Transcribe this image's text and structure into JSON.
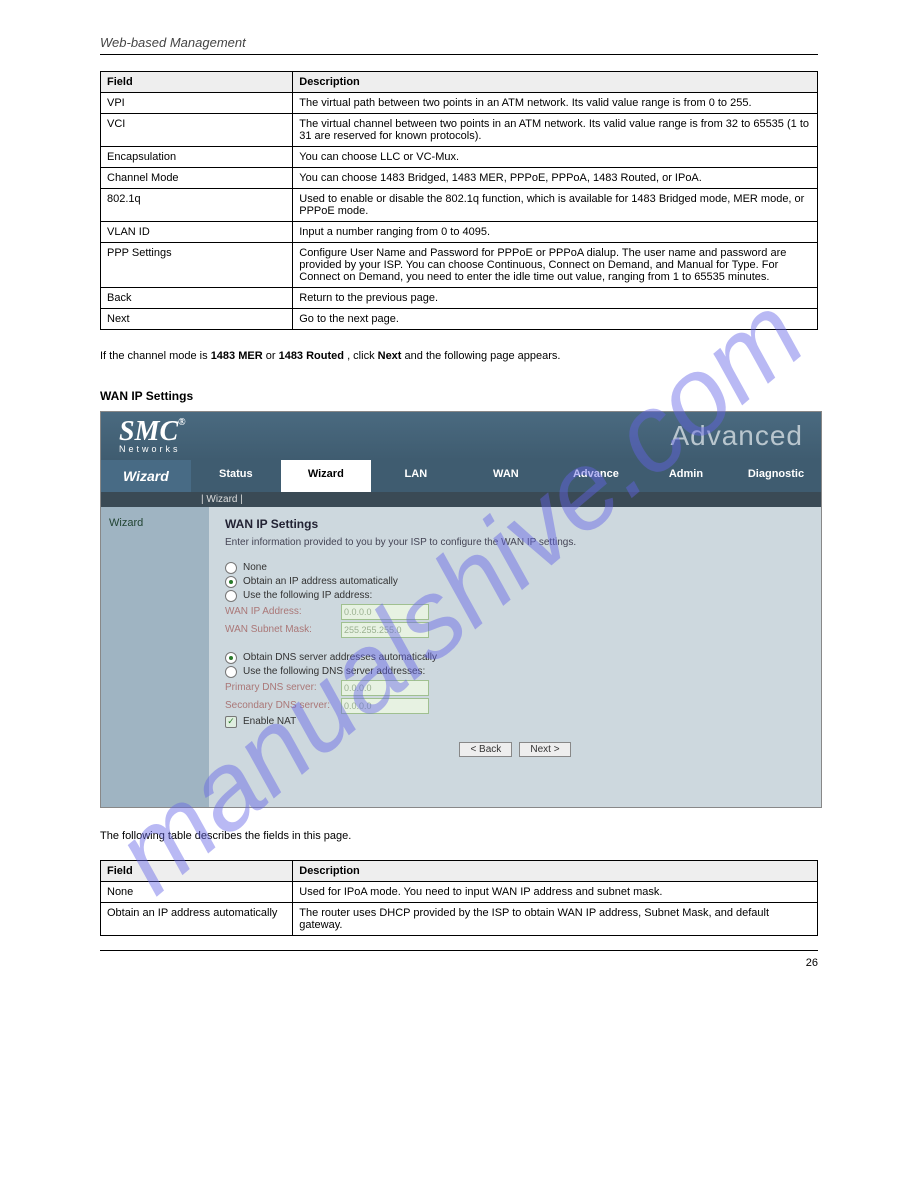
{
  "watermark": "manualshive.com",
  "section_title": "Web-based Management",
  "page_number": "26",
  "table1": {
    "header_field": "Field",
    "header_desc": "Description",
    "rows": [
      {
        "field": "VPI",
        "desc": "The virtual path between two points in an ATM network. Its valid value range is from 0 to 255."
      },
      {
        "field": "VCI",
        "desc": "The virtual channel between two points in an ATM network. Its valid value range is from 32 to 65535 (1 to 31 are reserved for known protocols)."
      },
      {
        "field": "Encapsulation",
        "desc": "You can choose LLC or VC-Mux."
      },
      {
        "field": "Channel Mode",
        "desc": "You can choose 1483 Bridged, 1483 MER, PPPoE, PPPoA, 1483 Routed, or IPoA."
      },
      {
        "field": "802.1q",
        "desc": "Used to enable or disable the 802.1q function, which is available for 1483 Bridged mode, MER mode, or PPPoE mode."
      },
      {
        "field": "VLAN ID",
        "desc": "Input a number ranging from 0 to 4095."
      },
      {
        "field": "PPP Settings",
        "desc": "Configure User Name and Password for PPPoE or PPPoA dialup. The user name and password are provided by your ISP. You can choose Continuous, Connect on Demand, and Manual for Type. For Connect on Demand, you need to enter the idle time out value, ranging from 1 to 65535 minutes."
      },
      {
        "field": "Back",
        "desc": "Return to the previous page."
      },
      {
        "field": "Next",
        "desc": "Go to the next page."
      }
    ]
  },
  "after_table_text_1": "If the channel mode is ",
  "after_table_bold_1": "1483 MER",
  "after_table_text_2": " or ",
  "after_table_bold_2": "1483 Routed",
  "after_table_text_3": ", click ",
  "after_table_bold_3": "Next",
  "after_table_text_4": " and the following page appears.",
  "subhead": "WAN IP Settings",
  "router": {
    "logo_main": "SMC",
    "logo_reg": "®",
    "logo_sub": "Networks",
    "advanced": "Advanced",
    "wizard_head": "Wizard",
    "tabs": [
      "Status",
      "Wizard",
      "LAN",
      "WAN",
      "Advance",
      "Admin",
      "Diagnostic"
    ],
    "active_tab_index": 1,
    "subtab": "| Wizard |",
    "side_link": "Wizard",
    "wan_title": "WAN IP Settings",
    "wan_sub": "Enter information provided to you by your ISP to configure the WAN IP settings.",
    "opt_none": "None",
    "opt_obtain_ip": "Obtain an IP address automatically",
    "opt_use_ip": "Use the following IP address:",
    "lbl_wan_ip": "WAN IP Address:",
    "lbl_wan_mask": "WAN Subnet Mask:",
    "val_wan_ip": "0.0.0.0",
    "val_wan_mask": "255.255.255.0",
    "opt_obtain_dns": "Obtain DNS server addresses automatically",
    "opt_use_dns": "Use the following DNS server addresses:",
    "lbl_primary_dns": "Primary DNS server:",
    "lbl_secondary_dns": "Secondary DNS server:",
    "val_primary_dns": "0.0.0.0",
    "val_secondary_dns": "0.0.0.0",
    "chk_nat": "Enable NAT",
    "btn_back": "< Back",
    "btn_next": "Next >"
  },
  "desc_after_shot": "The following table describes the fields in this page.",
  "table2": {
    "header_field": "Field",
    "header_desc": "Description",
    "rows": [
      {
        "field": "None",
        "desc": "Used for IPoA mode. You need to input WAN IP address and subnet mask."
      },
      {
        "field": "Obtain an IP address automatically",
        "desc": "The router uses DHCP provided by the ISP to obtain WAN IP address, Subnet Mask, and default gateway."
      }
    ]
  }
}
